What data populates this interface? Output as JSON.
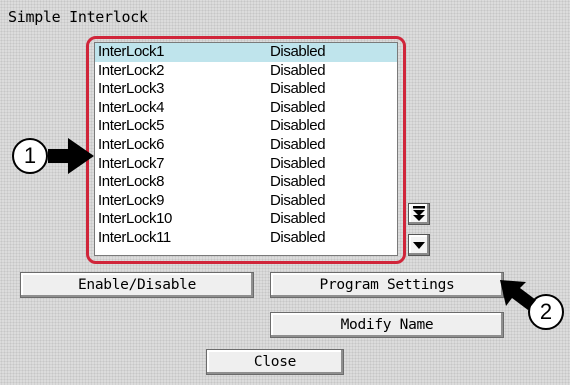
{
  "window": {
    "title": "Simple Interlock"
  },
  "interlock_list": {
    "rows": [
      {
        "name": "InterLock1",
        "status": "Disabled",
        "selected": true
      },
      {
        "name": "InterLock2",
        "status": "Disabled"
      },
      {
        "name": "InterLock3",
        "status": "Disabled"
      },
      {
        "name": "InterLock4",
        "status": "Disabled"
      },
      {
        "name": "InterLock5",
        "status": "Disabled"
      },
      {
        "name": "InterLock6",
        "status": "Disabled"
      },
      {
        "name": "InterLock7",
        "status": "Disabled"
      },
      {
        "name": "InterLock8",
        "status": "Disabled"
      },
      {
        "name": "InterLock9",
        "status": "Disabled"
      },
      {
        "name": "InterLock10",
        "status": "Disabled"
      },
      {
        "name": "InterLock11",
        "status": "Disabled"
      }
    ],
    "scroll_page_down_icon": "double-down-arrow",
    "scroll_down_icon": "down-arrow"
  },
  "buttons": {
    "enable_disable": "Enable/Disable",
    "program_settings": "Program Settings",
    "modify_name": "Modify Name",
    "close": "Close"
  },
  "callouts": {
    "one": "1",
    "two": "2"
  },
  "colors": {
    "highlight_outline": "#d0253a",
    "selected_row": "#bfe4ec"
  }
}
